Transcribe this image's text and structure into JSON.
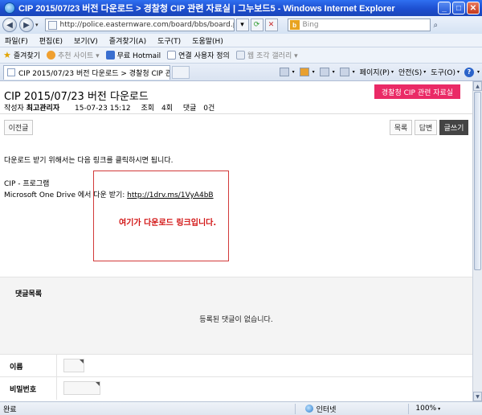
{
  "browser": {
    "window_title": "CIP 2015/07/23 버전 다운로드 > 경찰청 CIP 관련 자료실 | 그누보드5 - Windows Internet Explorer",
    "url": "http://police.easternware.com/board/bbs/board.php?b",
    "search_placeholder": "Bing",
    "menu": [
      "파일(F)",
      "편집(E)",
      "보기(V)",
      "즐겨찾기(A)",
      "도구(T)",
      "도움말(H)"
    ],
    "favorites": {
      "label": "즐겨찾기",
      "items": [
        "추천 사이트 ▾",
        "무료 Hotmail",
        "연결 사용자 정의",
        "웹 조각 갤러리 ▾"
      ]
    },
    "tab_title": "CIP 2015/07/23 버전 다운로드 > 경찰청 CIP 관...",
    "commands": [
      "페이지(P)",
      "안전(S)",
      "도구(O)"
    ],
    "status": {
      "left": "완료",
      "zone": "인터넷",
      "zoom": "100%"
    }
  },
  "post": {
    "title": "CIP 2015/07/23 버전 다운로드",
    "board_badge": "경찰청 CIP 관련 자료실",
    "author_label": "작성자",
    "author": "최고관리자",
    "date": "15-07-23 15:12",
    "views_label": "조회",
    "views": "4회",
    "comments_label": "댓글",
    "comments_count": "0건",
    "buttons": {
      "prev": "이전글",
      "list": "목록",
      "reply": "답변",
      "write": "글쓰기"
    },
    "body": {
      "intro": "다운로드 받기 위해서는 다음 링크를 클릭하시면 됩니다.",
      "program_label": "CIP - 프로그램",
      "download_text": "Microsoft One Drive 에서 다운 받기: ",
      "download_link": "http://1drv.ms/1VyA4bB",
      "annotation": "여기가 다운로드 링크입니다."
    }
  },
  "comments": {
    "heading": "댓글목록",
    "empty_message": "등록된 댓글이 없습니다."
  },
  "comment_form": {
    "name_label": "이름",
    "password_label": "비밀번호"
  },
  "colors": {
    "badge": "#ea2a66",
    "annotation": "#d21414",
    "titlebar": "#1d4fd0"
  }
}
